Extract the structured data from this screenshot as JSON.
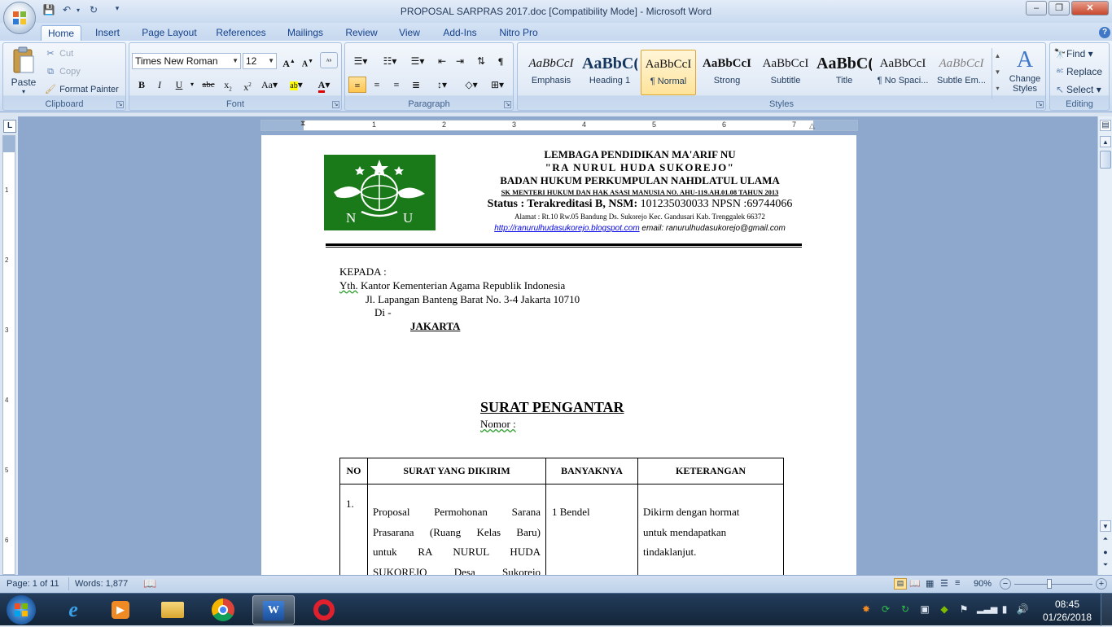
{
  "window": {
    "title": "PROPOSAL SARPRAS 2017.doc [Compatibility Mode] - Microsoft Word"
  },
  "tabs": [
    "Home",
    "Insert",
    "Page Layout",
    "References",
    "Mailings",
    "Review",
    "View",
    "Add-Ins",
    "Nitro Pro"
  ],
  "clipboard": {
    "paste": "Paste",
    "cut": "Cut",
    "copy": "Copy",
    "format_painter": "Format Painter",
    "label": "Clipboard"
  },
  "font": {
    "family": "Times New Roman",
    "size": "12",
    "label": "Font"
  },
  "paragraph": {
    "label": "Paragraph"
  },
  "styles": {
    "label": "Styles",
    "change_styles": "Change Styles",
    "items": [
      {
        "preview": "AaBbCcI",
        "name": "Emphasis"
      },
      {
        "preview": "AaBbC(",
        "name": "Heading 1"
      },
      {
        "preview": "AaBbCcI",
        "name": "¶ Normal"
      },
      {
        "preview": "AaBbCcI",
        "name": "Strong"
      },
      {
        "preview": "AaBbCcI",
        "name": "Subtitle"
      },
      {
        "preview": "AaBbC(",
        "name": "Title"
      },
      {
        "preview": "AaBbCcI",
        "name": "¶ No Spaci..."
      },
      {
        "preview": "AaBbCcI",
        "name": "Subtle Em..."
      }
    ]
  },
  "editing": {
    "find": "Find",
    "replace": "Replace",
    "select": "Select",
    "label": "Editing"
  },
  "ruler": {
    "marks": [
      "1",
      "2",
      "3",
      "4",
      "5",
      "6",
      "7"
    ],
    "vmarks": [
      "1",
      "2",
      "3",
      "4",
      "5",
      "6"
    ]
  },
  "letterhead": {
    "line1": "LEMBAGA PENDIDIKAN MA'ARIF NU",
    "line2": "\"RA NURUL HUDA SUKOREJO\"",
    "line3": "BADAN HUKUM PERKUMPULAN NAHDLATUL ULAMA",
    "line4": "SK MENTERI HUKUM DAN HAK ASASI MANUSIA NO. AHU-119.AH.01.08 TAHUN 2013",
    "status_label": "Status : Terakreditasi  B, NSM:",
    "status_value": " 101235030033 NPSN :69744066",
    "address": "Alamat : Rt.10 Rw.05 Bandung Ds. Sukorejo Kec. Gandusari Kab. Trenggalek 66372",
    "url": "http://ranurulhudasukorejo.blogspot.com",
    "email": "  email:  ranurulhudasukorejo@gmail.com",
    "logo_letters": [
      "N",
      "U"
    ]
  },
  "letter": {
    "to": "KEPADA :",
    "yth": "Yth.",
    "recipient": " Kantor Kementerian Agama Republik Indonesia",
    "address": "Jl. Lapangan Banteng Barat No. 3-4 Jakarta 10710",
    "di": "Di -",
    "city": "JAKARTA",
    "title": "SURAT PENGANTAR",
    "nomor": "Nomor  :"
  },
  "table": {
    "headers": [
      "NO",
      "SURAT YANG DIKIRIM",
      "BANYAKNYA",
      "KETERANGAN"
    ],
    "row1": {
      "no": "1.",
      "surat": [
        "Proposal Permohonan Sarana",
        "Prasarana (Ruang Kelas Baru)",
        "untuk RA NURUL HUDA",
        "SUKOREJO Desa Sukorejo"
      ],
      "banyak": "1 Bendel",
      "ket": [
        "Dikirm dengan hormat",
        "untuk mendapatkan",
        "tindaklanjut."
      ]
    }
  },
  "status": {
    "page": "Page: 1 of 11",
    "words": "Words: 1,877",
    "zoom": "90%"
  },
  "clock": {
    "time": "08:45",
    "date": "01/26/2018"
  }
}
